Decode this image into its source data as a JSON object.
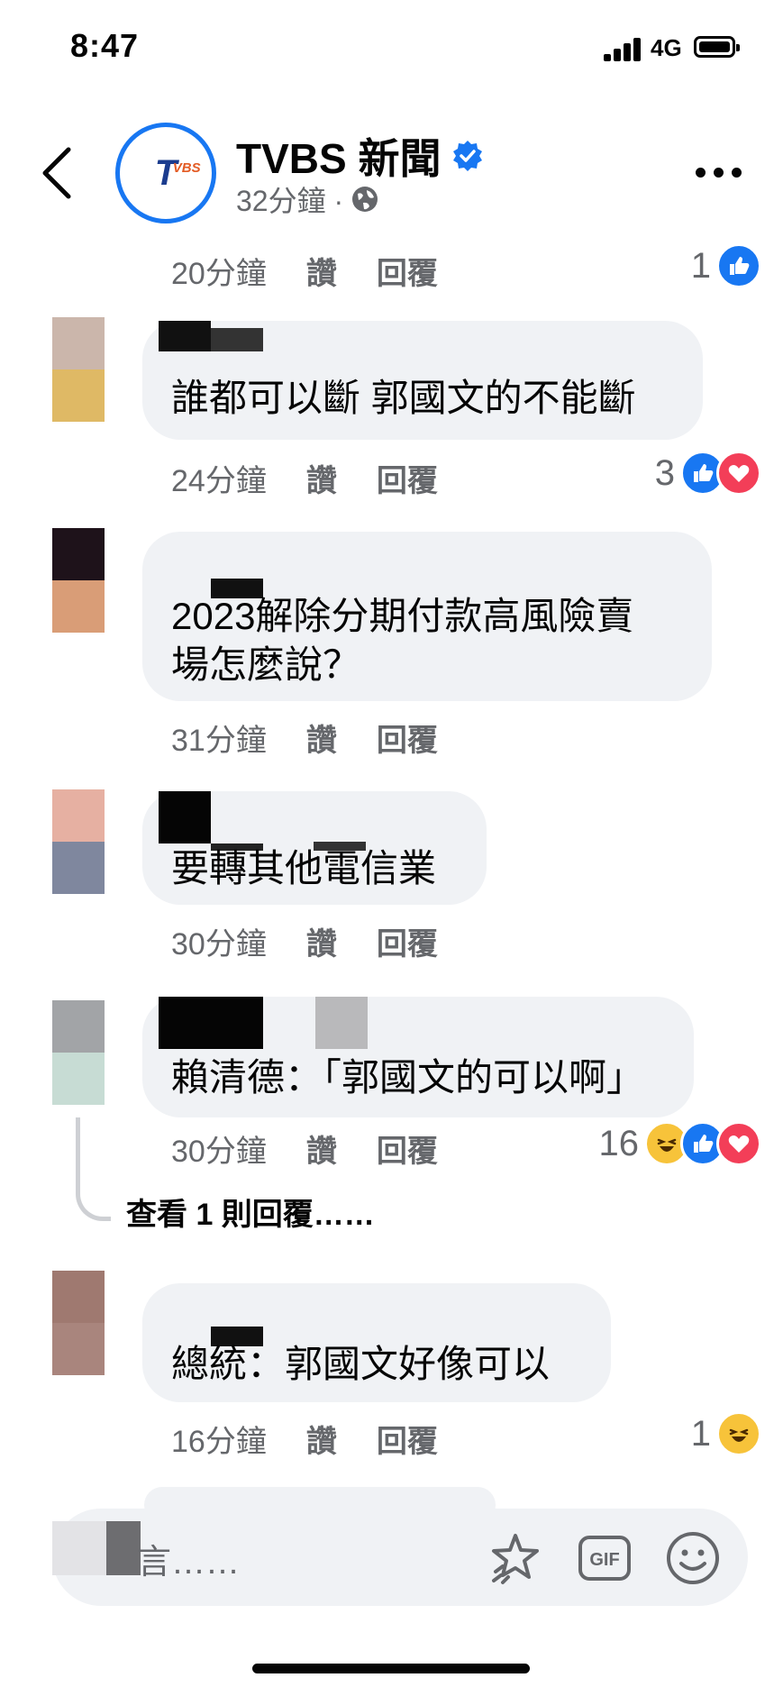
{
  "status_bar": {
    "time": "8:47",
    "network": "4G"
  },
  "header": {
    "page_name": "TVBS 新聞",
    "meta_time": "32分鐘 ·",
    "logo_text": "TVBS 新聞"
  },
  "prev_comment": {
    "time": "20分鐘",
    "like_label": "讚",
    "reply_label": "回覆",
    "reaction_count": "1"
  },
  "comments": [
    {
      "text": "誰都可以斷 郭國文的不能斷",
      "time": "24分鐘",
      "like_label": "讚",
      "reply_label": "回覆",
      "reaction_count": "3"
    },
    {
      "text_line1": "2023解除分期付款高風險賣",
      "text_line2": "場怎麼說？",
      "time": "31分鐘",
      "like_label": "讚",
      "reply_label": "回覆"
    },
    {
      "text": "要轉其他電信業",
      "time": "30分鐘",
      "like_label": "讚",
      "reply_label": "回覆"
    },
    {
      "text": "賴清德：「郭國文的可以啊」",
      "time": "30分鐘",
      "like_label": "讚",
      "reply_label": "回覆",
      "reaction_count": "16"
    },
    {
      "text": "總統：郭國文好像可以",
      "time": "16分鐘",
      "like_label": "讚",
      "reply_label": "回覆",
      "reaction_count": "1"
    }
  ],
  "view_replies": "查看 1 則回覆……",
  "composer": {
    "placeholder": "言……"
  },
  "colors": {
    "facebook_blue": "#1877f2",
    "love_red": "#f33e58",
    "bubble_gray": "#f0f2f5",
    "meta_gray": "#65676b"
  }
}
